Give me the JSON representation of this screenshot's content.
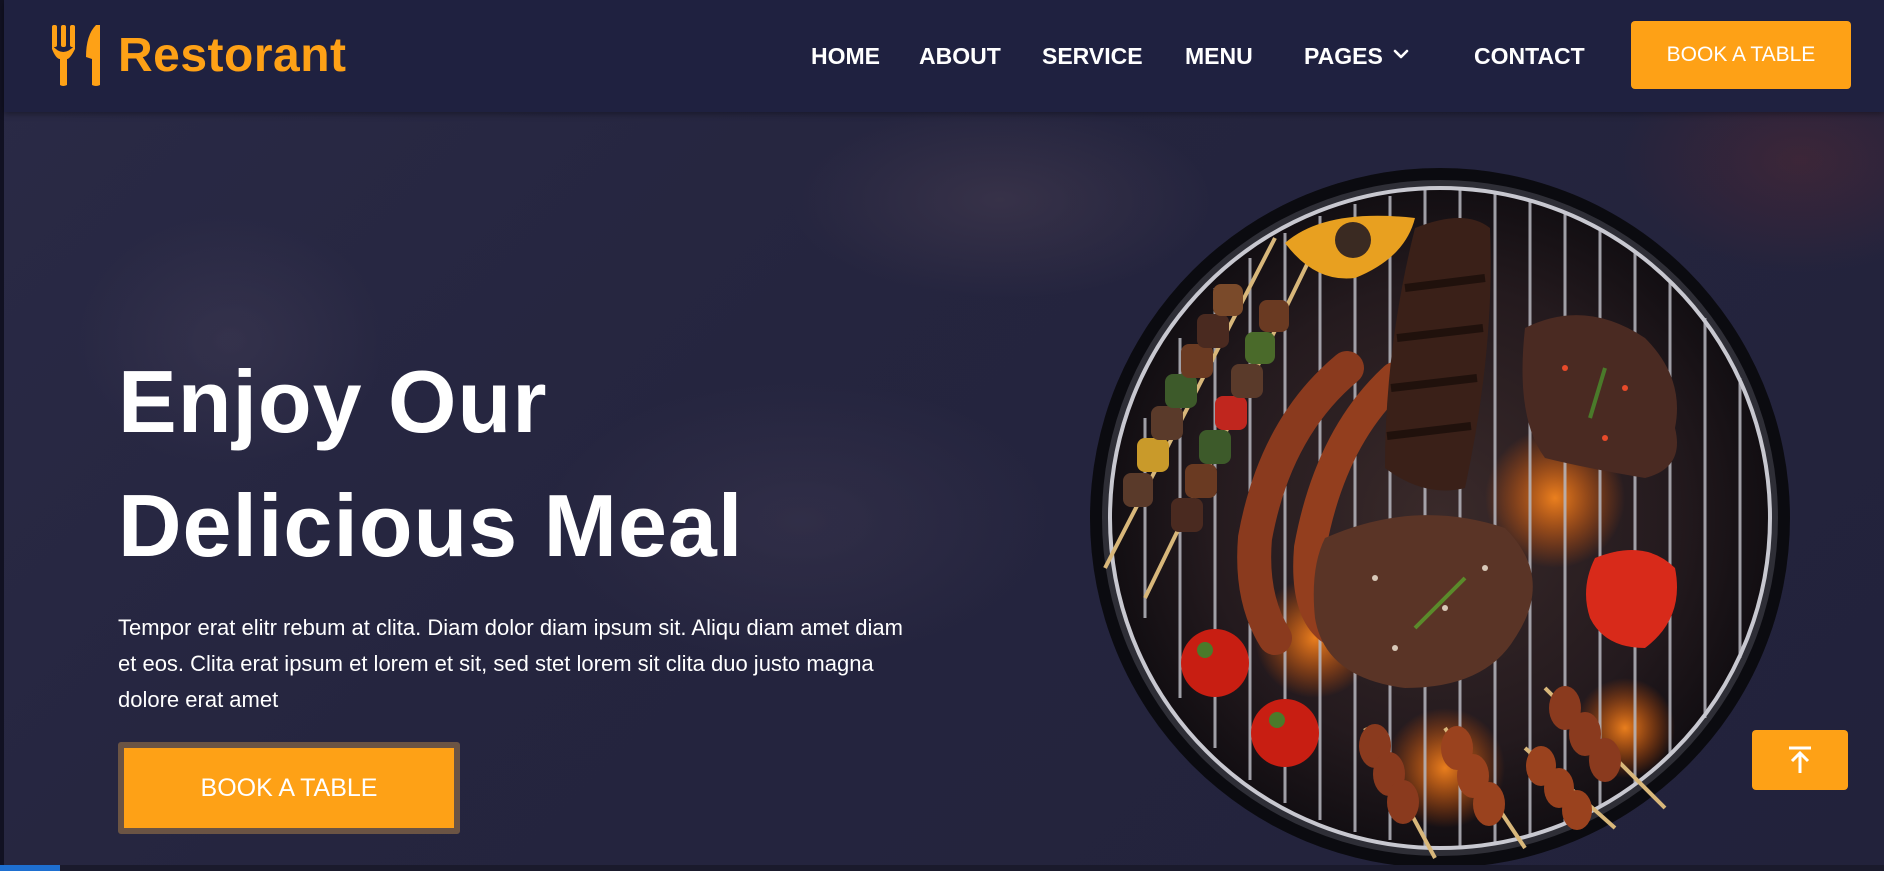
{
  "brand": {
    "name": "Restorant",
    "icon": "utensils-icon"
  },
  "nav": {
    "items": [
      {
        "label": "HOME"
      },
      {
        "label": "ABOUT"
      },
      {
        "label": "SERVICE"
      },
      {
        "label": "MENU"
      },
      {
        "label": "PAGES",
        "icon": "chevron-down-icon"
      },
      {
        "label": "CONTACT"
      }
    ],
    "cta_label": "BOOK A TABLE"
  },
  "hero": {
    "title_line1": "Enjoy Our",
    "title_line2": "Delicious Meal",
    "text": "Tempor erat elitr rebum at clita. Diam dolor diam ipsum sit. Aliqu diam amet diam et eos. Clita erat ipsum et lorem et sit, sed stet lorem sit clita duo justo magna dolore erat amet",
    "cta_label": "BOOK A TABLE",
    "image": "bbq-grill-image"
  },
  "back_to_top": {
    "icon": "arrow-up-icon"
  },
  "colors": {
    "accent": "#fea116",
    "nav_bg": "#1f2140",
    "hero_bg": "#23233d",
    "text": "#ffffff"
  }
}
